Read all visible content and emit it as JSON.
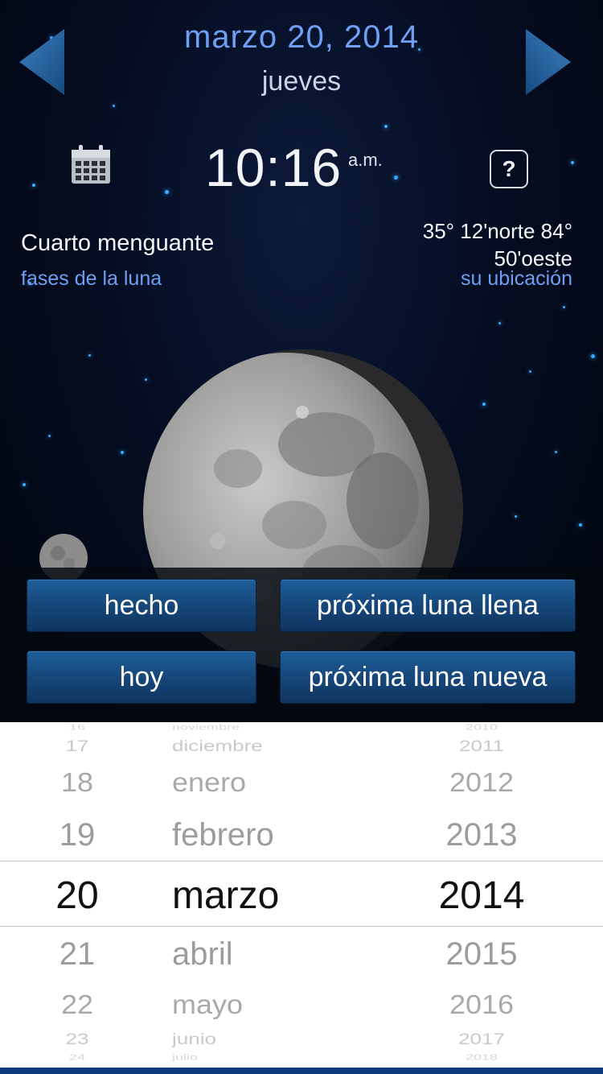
{
  "header": {
    "date": "marzo 20, 2014",
    "weekday": "jueves"
  },
  "clock": {
    "time": "10:16",
    "ampm": "a.m."
  },
  "help": {
    "label": "?"
  },
  "phase": {
    "name": "Cuarto menguante",
    "link": "fases de la luna",
    "illumination": "86.1%"
  },
  "location": {
    "coords_line1": "35° 12'norte   84°",
    "coords_line2": "50'oeste",
    "link": "su ubicación"
  },
  "buttons": {
    "done": "hecho",
    "next_full": "próxima luna llena",
    "today": "hoy",
    "next_new": "próxima luna nueva"
  },
  "picker": {
    "days": [
      "16",
      "17",
      "18",
      "19",
      "20",
      "21",
      "22",
      "23",
      "24"
    ],
    "months": [
      "noviembre",
      "diciembre",
      "enero",
      "febrero",
      "marzo",
      "abril",
      "mayo",
      "junio",
      "julio"
    ],
    "years": [
      "2010",
      "2011",
      "2012",
      "2013",
      "2014",
      "2015",
      "2016",
      "2017",
      "2018"
    ],
    "selected": {
      "day": "20",
      "month": "marzo",
      "year": "2014"
    }
  },
  "colors": {
    "accent_blue": "#6f9ff2",
    "button_blue": "#16477a",
    "star_blue": "#3aa8ff"
  },
  "icons": [
    "arrow-left-icon",
    "arrow-right-icon",
    "calendar-icon",
    "help-icon"
  ]
}
